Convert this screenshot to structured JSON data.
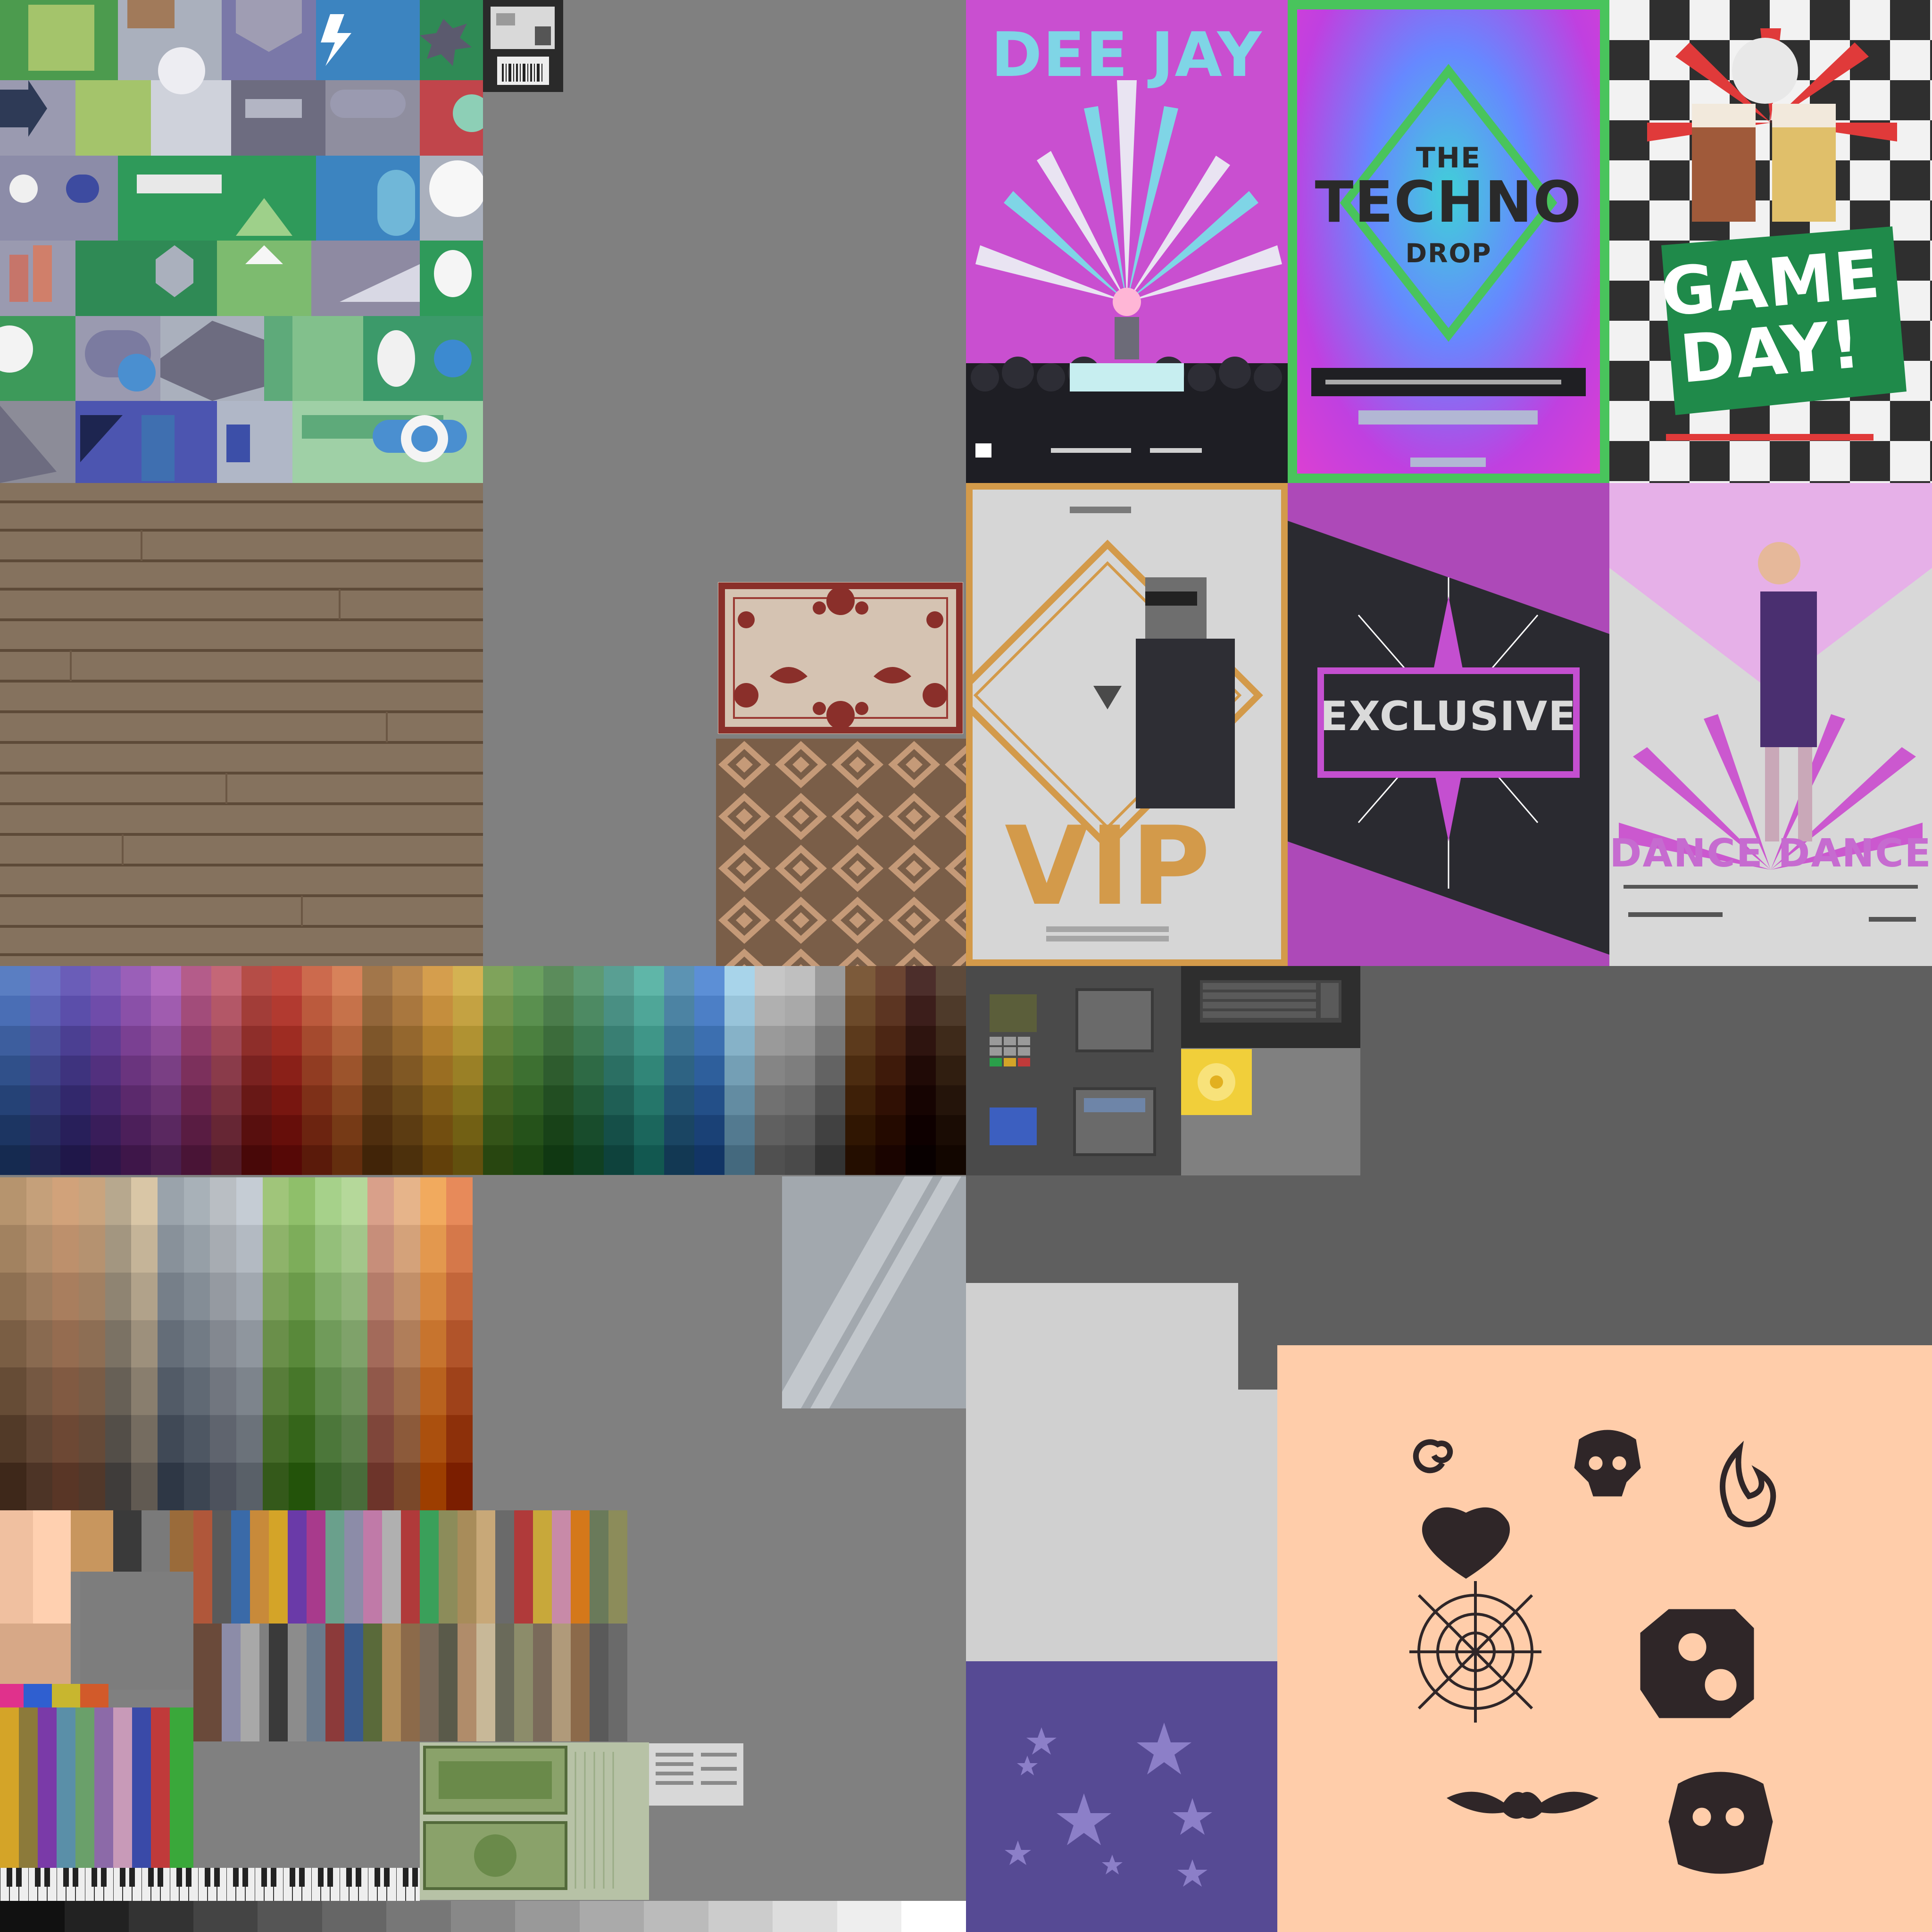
{
  "posters": {
    "deejay": {
      "title": "DEE JAY"
    },
    "techno": {
      "line1": "THE",
      "line2": "TECHNO",
      "line3": "DROP"
    },
    "gameday": {
      "line1": "GAME",
      "line2": "DAY!"
    },
    "vip": {
      "title": "VIP"
    },
    "exclusive": {
      "title": "EXCLUSIVE"
    },
    "dance": {
      "title": "DANCE DANCE"
    }
  },
  "colors": {
    "background": "#808080",
    "dark_gray": "#5f5f5f",
    "poster_magenta": "#c94fd0",
    "peach": "#ffcdaa",
    "purple": "#564a94",
    "gold": "#d39a4a",
    "wood": "#85725e"
  },
  "icons": [
    "swirl-icon",
    "skull-icon",
    "flame-icon",
    "heart-icon",
    "cobweb-icon",
    "gears-icon",
    "tribal-icon",
    "skull-gears-icon"
  ],
  "palette_main": [
    [
      "#5a7ec2",
      "#6b72c4",
      "#6a5db8",
      "#7f5cb8",
      "#9a5fb8",
      "#b26cc0",
      "#b45c8a",
      "#c46777",
      "#b54d47",
      "#c24a3f",
      "#cc6a4d",
      "#d7825a",
      "#a2764a",
      "#b9874e",
      "#d59e4d",
      "#d4b252",
      "#7fa35b",
      "#6aa05f",
      "#5b8c5b",
      "#5d9a73",
      "#599f93",
      "#5fb6a8",
      "#5c93b3",
      "#5c8fd6",
      "#a8d4ea",
      "#c6c6c6",
      "#bfbfbf",
      "#9a9a9a",
      "#7c5a3a",
      "#6c4532",
      "#4c2e2b",
      "#5e4a3a"
    ],
    [
      "#4a6eb5",
      "#5c62b5",
      "#5b4eaa",
      "#6f4caa",
      "#8a50a8",
      "#a05caf",
      "#a24c7a",
      "#b35767",
      "#a23d38",
      "#b23a30",
      "#bb5a3d",
      "#c6724a",
      "#92663a",
      "#a9773e",
      "#c58e3d",
      "#c4a242",
      "#6f934b",
      "#5a904f",
      "#4b7c4b",
      "#4d8a63",
      "#498f83",
      "#4fa698",
      "#4c83a3",
      "#4c7fc6",
      "#98c4da",
      "#b0b0b0",
      "#a9a9a9",
      "#8a8a8a",
      "#6c4a2a",
      "#5c3522",
      "#3c1e1b",
      "#4e3a2a"
    ],
    [
      "#3d5e9e",
      "#4c529e",
      "#4b3f92",
      "#5f3c92",
      "#7a4092",
      "#8d4c98",
      "#8f3c6a",
      "#9e4757",
      "#8e2e2a",
      "#9e2c22",
      "#a54a2e",
      "#b1623a",
      "#7e562a",
      "#94672e",
      "#b07e2d",
      "#b09232",
      "#5f833b",
      "#4b803f",
      "#3c6c3b",
      "#3d7a53",
      "#397f73",
      "#3f9688",
      "#3c7393",
      "#3c6fb0",
      "#86b2c8",
      "#9a9a9a",
      "#939393",
      "#767676",
      "#5c3a1c",
      "#4c2614",
      "#2e140f",
      "#3e2a1a"
    ],
    [
      "#30508a",
      "#3f448a",
      "#3e337e",
      "#52307e",
      "#6a347e",
      "#7a3f84",
      "#7c305c",
      "#8a3b4a",
      "#7a2220",
      "#8a2018",
      "#913c22",
      "#9c542c",
      "#6e4820",
      "#805824",
      "#9a6e22",
      "#9a8026",
      "#4f732e",
      "#3d7031",
      "#2e5c2e",
      "#2e6a45",
      "#2b6f63",
      "#318678",
      "#2e6383",
      "#2e5f9c",
      "#749fb5",
      "#858585",
      "#7e7e7e",
      "#636363",
      "#4c2c10",
      "#3e1a0a",
      "#200a06",
      "#301e10"
    ],
    [
      "#254276",
      "#333876",
      "#32286c",
      "#45266c",
      "#5b296c",
      "#6a3372",
      "#6a254e",
      "#78303e",
      "#681816",
      "#781610",
      "#7e3018",
      "#884620",
      "#5e3a16",
      "#6c4a1a",
      "#845e18",
      "#84701c",
      "#416322",
      "#306024",
      "#224e22",
      "#225a38",
      "#1f5f55",
      "#25766a",
      "#235373",
      "#234f88",
      "#638ca2",
      "#717171",
      "#6a6a6a",
      "#515151",
      "#3e2008",
      "#301004",
      "#160402",
      "#24140a"
    ],
    [
      "#1c3562",
      "#282d62",
      "#281f5a",
      "#391d5a",
      "#4c1f5a",
      "#5a2860",
      "#591c42",
      "#662634",
      "#580f0e",
      "#660e0a",
      "#6c2410",
      "#763a16",
      "#4f2e0e",
      "#5c3c12",
      "#724e10",
      "#726014",
      "#345418",
      "#25521a",
      "#184218",
      "#184c2c",
      "#154f48",
      "#1b665c",
      "#1a4563",
      "#1a4176",
      "#537a90",
      "#606060",
      "#5a5a5a",
      "#414141",
      "#301602",
      "#240a00",
      "#0e0000",
      "#1a0c04"
    ],
    [
      "#152a50",
      "#1f2350",
      "#1f1749",
      "#2e1549",
      "#3e1649",
      "#4a1e4e",
      "#491436",
      "#541c2a",
      "#480808",
      "#560806",
      "#5a1a0a",
      "#642e0e",
      "#412408",
      "#4c300c",
      "#62400a",
      "#62500e",
      "#284610",
      "#1c4612",
      "#103812",
      "#104022",
      "#0e423c",
      "#125850",
      "#123853",
      "#123565",
      "#44697e",
      "#505050",
      "#4a4a4a",
      "#333333",
      "#240e00",
      "#1a0400",
      "#080000",
      "#120600"
    ]
  ],
  "palette_earth": [
    [
      "#b6946e",
      "#c5a07a",
      "#d1a27a",
      "#c9a47e",
      "#b7a88e",
      "#d9c6a6",
      "#9aa3ab",
      "#a8b1b8",
      "#b9bec3",
      "#c5ccd4",
      "#a0c57a",
      "#8fbf6a",
      "#a6d18a",
      "#b5d89a",
      "#d9a08a",
      "#e6b48a",
      "#f1aa5e",
      "#e78a5a"
    ],
    [
      "#a28260",
      "#b18e6c",
      "#bd906c",
      "#b59270",
      "#a39680",
      "#c5b498",
      "#88919a",
      "#969fa7",
      "#a7acb2",
      "#b3bac2",
      "#8eb36a",
      "#7dad5a",
      "#94bf7a",
      "#a3c68a",
      "#c78e7a",
      "#d4a27a",
      "#e3984e",
      "#d5784a"
    ],
    [
      "#8e7052",
      "#9d7c5e",
      "#a97e5e",
      "#a18062",
      "#8f8472",
      "#b1a28a",
      "#767f89",
      "#848d96",
      "#959aa1",
      "#a1a8b0",
      "#7ca15a",
      "#6b9b4a",
      "#82ad6a",
      "#91b47a",
      "#b57c6a",
      "#c2906a",
      "#d5863e",
      "#c3663a"
    ],
    [
      "#7a5e44",
      "#896a50",
      "#956c50",
      "#8d6e54",
      "#7b7264",
      "#9d907c",
      "#646d78",
      "#727b85",
      "#838890",
      "#8f969e",
      "#6a8f4a",
      "#59893a",
      "#709b5a",
      "#7fa26a",
      "#a36a5a",
      "#b07e5a",
      "#c7742e",
      "#b1542a"
    ],
    [
      "#664c36",
      "#755842",
      "#815a42",
      "#795c46",
      "#676056",
      "#897e6e",
      "#525b67",
      "#606974",
      "#71767f",
      "#7d848c",
      "#587d3a",
      "#47772a",
      "#5e894a",
      "#6d905a",
      "#91584a",
      "#9e6c4a",
      "#b9621e",
      "#9f421a"
    ],
    [
      "#523a28",
      "#614634",
      "#6d4834",
      "#654a38",
      "#534e48",
      "#756c60",
      "#404956",
      "#4e5763",
      "#5f646e",
      "#6b727a",
      "#466b2a",
      "#35651a",
      "#4c773a",
      "#5b7e4a",
      "#7f463a",
      "#8c5a3a",
      "#ab500e",
      "#8d300a"
    ],
    [
      "#3e281a",
      "#4d3426",
      "#593626",
      "#51382a",
      "#3f3c3a",
      "#615a52",
      "#2e3745",
      "#3c4552",
      "#4d525d",
      "#596068",
      "#34591a",
      "#23530a",
      "#3a652a",
      "#496c3a",
      "#6d342a",
      "#7a482a",
      "#9d3e00",
      "#7b1e00"
    ]
  ],
  "palette_gray_strip": [
    "#111111",
    "#222222",
    "#333333",
    "#444444",
    "#555555",
    "#666666",
    "#777777",
    "#888888",
    "#999999",
    "#aaaaaa",
    "#bbbbbb",
    "#cccccc",
    "#dddddd",
    "#eeeeee",
    "#ffffff"
  ]
}
